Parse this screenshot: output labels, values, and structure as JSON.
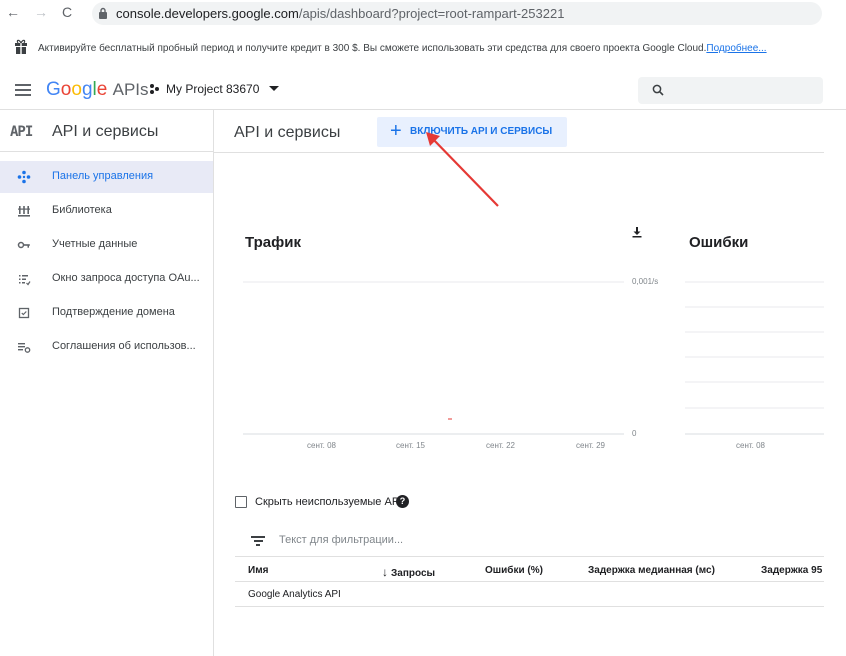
{
  "browser": {
    "url_host": "console.developers.google.com",
    "url_rest": "/apis/dashboard?project=root-rampart-253221"
  },
  "promo": {
    "text": "Активируйте бесплатный пробный период и получите кредит в 300 $. Вы сможете использовать эти средства для своего проекта Google Cloud.",
    "link": "Подробнее..."
  },
  "header": {
    "logo_google": "Google",
    "logo_apis": "APIs",
    "project_name": "My Project 83670"
  },
  "sidebar": {
    "badge": "API",
    "title": "API и сервисы",
    "items": [
      {
        "label": "Панель управления",
        "icon": "dashboard-icon",
        "active": true
      },
      {
        "label": "Библиотека",
        "icon": "library-icon",
        "active": false
      },
      {
        "label": "Учетные данные",
        "icon": "key-icon",
        "active": false
      },
      {
        "label": "Окно запроса доступа OAu...",
        "icon": "consent-icon",
        "active": false
      },
      {
        "label": "Подтверждение домена",
        "icon": "checkbox-icon",
        "active": false
      },
      {
        "label": "Соглашения об использов...",
        "icon": "settings-list-icon",
        "active": false
      }
    ]
  },
  "main": {
    "title": "API и сервисы",
    "enable_button": "ВКЛЮЧИТЬ API И СЕРВИСЫ"
  },
  "charts": {
    "traffic_title": "Трафик",
    "errors_title": "Ошибки"
  },
  "chart_data": [
    {
      "type": "line",
      "title": "Трафик",
      "x": [
        "сент. 08",
        "сент. 15",
        "сент. 22",
        "сент. 29"
      ],
      "y_ticks": [
        "0",
        "0,001/s"
      ],
      "ylim": [
        0,
        0.001
      ],
      "series": [],
      "grid": true
    },
    {
      "type": "line",
      "title": "Ошибки",
      "x": [
        "сент. 08"
      ],
      "series": [],
      "grid": true
    }
  ],
  "table": {
    "hide_unused_label": "Скрыть неиспользуемые API",
    "filter_placeholder": "Текст для фильтрации...",
    "columns": [
      "Имя",
      "Запросы",
      "Ошибки (%)",
      "Задержка медианная (мс)",
      "Задержка 95"
    ],
    "rows": [
      {
        "name": "Google Analytics API"
      }
    ]
  },
  "colors": {
    "accent": "#1a73e8",
    "active_bg": "#e8eaf6",
    "annotation_arrow": "#e53935"
  }
}
